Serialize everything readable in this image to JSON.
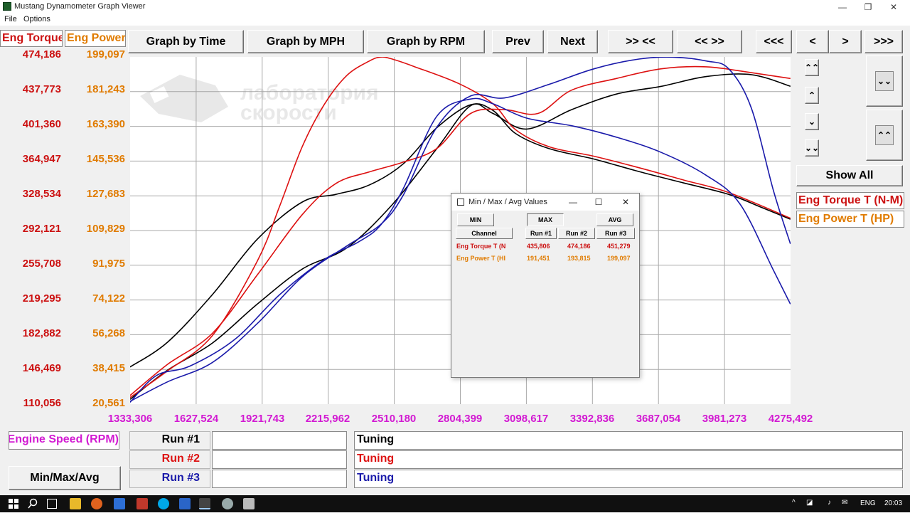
{
  "window": {
    "title": "Mustang Dynamometer Graph Viewer"
  },
  "menu": {
    "file": "File",
    "options": "Options"
  },
  "channels": {
    "torque_header": "Eng Torque T (N-M)",
    "power_header": "Eng Power T (HP)"
  },
  "toolbar": {
    "graph_time": "Graph by Time",
    "graph_mph": "Graph by MPH",
    "graph_rpm": "Graph by RPM",
    "prev": "Prev",
    "next": "Next",
    "zoom_in": ">> <<",
    "zoom_out": "<< >>",
    "first": "<<<",
    "back": "<",
    "forward": ">",
    "last": ">>>"
  },
  "side": {
    "show_all": "Show All",
    "up_fast_glyph": "⌃⌃",
    "up_glyph": "⌃",
    "down_glyph": "⌄",
    "down_fast_glyph": "⌄⌄",
    "scale_in_glyph": "⌄⌄",
    "scale_out_glyph": "⌃⌃"
  },
  "y_torque": [
    "474,186",
    "437,773",
    "401,360",
    "364,947",
    "328,534",
    "292,121",
    "255,708",
    "219,295",
    "182,882",
    "146,469",
    "110,056"
  ],
  "y_power": [
    "199,097",
    "181,243",
    "163,390",
    "145,536",
    "127,683",
    "109,829",
    "91,975",
    "74,122",
    "56,268",
    "38,415",
    "20,561"
  ],
  "x_labels": [
    "1333,306",
    "1627,524",
    "1921,743",
    "2215,962",
    "2510,180",
    "2804,399",
    "3098,617",
    "3392,836",
    "3687,054",
    "3981,273",
    "4275,492"
  ],
  "bottom": {
    "x_channel": "Engine Speed (RPM)",
    "minmax_button": "Min/Max/Avg",
    "runs": [
      {
        "label": "Run #1",
        "note": "Tuning",
        "color": "#000000"
      },
      {
        "label": "Run #2",
        "note": "Tuning",
        "color": "#dd1111"
      },
      {
        "label": "Run #3",
        "note": "Tuning",
        "color": "#1a1aaa"
      }
    ]
  },
  "watermark": {
    "line1": "лаборатория",
    "line2": "скорости"
  },
  "popup": {
    "title": "Min / Max / Avg Values",
    "btn_min": "MIN",
    "btn_max": "MAX",
    "btn_avg": "AVG",
    "headers": [
      "Channel",
      "Run #1",
      "Run #2",
      "Run #3"
    ],
    "rows": [
      {
        "channel": "Eng Torque T (N",
        "values": [
          "435,806",
          "474,186",
          "451,279"
        ],
        "color": "#cc1111"
      },
      {
        "channel": "Eng Power T (HI",
        "values": [
          "191,451",
          "193,815",
          "199,097"
        ],
        "color": "#e07b00"
      }
    ]
  },
  "taskbar": {
    "lang": "ENG",
    "time": "20:03"
  },
  "colors": {
    "torque": "#cc1111",
    "power": "#e07b00",
    "rpm": "#d21ad2",
    "run1": "#000000",
    "run2": "#dd1111",
    "run3": "#1a1aaa"
  },
  "chart_data": {
    "type": "line",
    "xlabel": "Engine Speed (RPM)",
    "xlim": [
      1333.306,
      4275.492
    ],
    "ylim_torque": [
      110.056,
      474.186
    ],
    "ylim_power": [
      20.561,
      199.097
    ],
    "series": [
      {
        "name": "Run #1",
        "channel": "Eng Torque T (N-M)",
        "color": "#000000",
        "x": [
          1333,
          1500,
          1700,
          1900,
          2100,
          2250,
          2400,
          2550,
          2700,
          2850,
          2950,
          3050,
          3200,
          3400,
          3600,
          3800,
          4000,
          4150,
          4275
        ],
        "y": [
          149,
          175,
          225,
          283,
          322,
          330,
          340,
          362,
          400,
          424,
          418,
          394,
          378,
          367,
          354,
          342,
          330,
          316,
          304
        ]
      },
      {
        "name": "Run #1",
        "channel": "Eng Power T (HP)",
        "color": "#000000",
        "x": [
          1333,
          1500,
          1700,
          1900,
          2100,
          2300,
          2500,
          2700,
          2850,
          2950,
          3100,
          3300,
          3500,
          3700,
          3900,
          4100,
          4275
        ],
        "y": [
          23,
          38,
          52,
          72,
          90,
          101,
          123,
          152,
          174,
          170,
          162,
          172,
          180,
          184,
          189,
          190,
          184
        ]
      },
      {
        "name": "Run #2",
        "channel": "Eng Torque T (N-M)",
        "color": "#dd1111",
        "x": [
          1333,
          1500,
          1700,
          1900,
          2000,
          2100,
          2200,
          2300,
          2400,
          2450,
          2500,
          2600,
          2800,
          2950,
          3050,
          3200,
          3400,
          3600,
          3800,
          4000,
          4275
        ],
        "y": [
          117,
          145,
          182,
          260,
          318,
          380,
          425,
          455,
          470,
          474,
          472,
          464,
          446,
          425,
          398,
          380,
          370,
          358,
          345,
          332,
          305
        ]
      },
      {
        "name": "Run #2",
        "channel": "Eng Power T (HP)",
        "color": "#dd1111",
        "x": [
          1333,
          1500,
          1700,
          1900,
          2100,
          2250,
          2400,
          2550,
          2700,
          2850,
          3000,
          3150,
          3300,
          3500,
          3700,
          3900,
          4100,
          4275
        ],
        "y": [
          25,
          41,
          57,
          87,
          118,
          134,
          140,
          145,
          152,
          170,
          172,
          170,
          182,
          188,
          193,
          194,
          191,
          188
        ]
      },
      {
        "name": "Run #3",
        "channel": "Eng Torque T (N-M)",
        "color": "#1a1aaa",
        "x": [
          1333,
          1450,
          1600,
          1800,
          2000,
          2200,
          2350,
          2450,
          2550,
          2700,
          2850,
          2950,
          3100,
          3300,
          3500,
          3700,
          3900,
          4050,
          4200,
          4275
        ],
        "y": [
          112,
          140,
          150,
          178,
          225,
          262,
          280,
          298,
          336,
          412,
          430,
          425,
          410,
          402,
          390,
          374,
          350,
          320,
          250,
          215
        ]
      },
      {
        "name": "Run #3",
        "channel": "Eng Power T (HP)",
        "color": "#1a1aaa",
        "x": [
          1333,
          1500,
          1700,
          1900,
          2100,
          2300,
          2450,
          2550,
          2700,
          2850,
          3000,
          3200,
          3400,
          3600,
          3750,
          3900,
          4000,
          4100,
          4200,
          4275
        ],
        "y": [
          22,
          32,
          42,
          62,
          86,
          102,
          113,
          128,
          163,
          179,
          178,
          185,
          193,
          198,
          199,
          197,
          193,
          173,
          130,
          103
        ]
      }
    ]
  }
}
